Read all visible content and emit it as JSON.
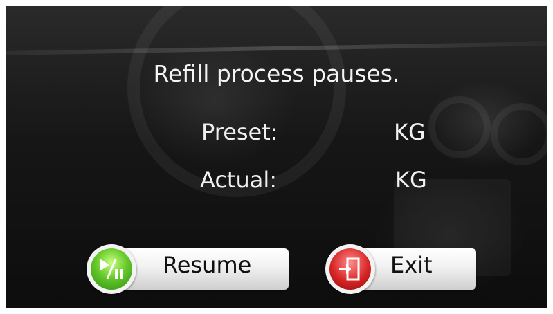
{
  "dialog": {
    "title": "Refill process pauses.",
    "preset_label": "Preset:",
    "preset_unit": "KG",
    "actual_label": "Actual:",
    "actual_unit": "KG"
  },
  "buttons": {
    "resume_label": "Resume",
    "resume_icon": "play-pause-icon",
    "exit_label": "Exit",
    "exit_icon": "exit-door-icon"
  },
  "colors": {
    "resume_accent": "#4fb81f",
    "exit_accent": "#d62525",
    "text": "#f4f4f4"
  }
}
